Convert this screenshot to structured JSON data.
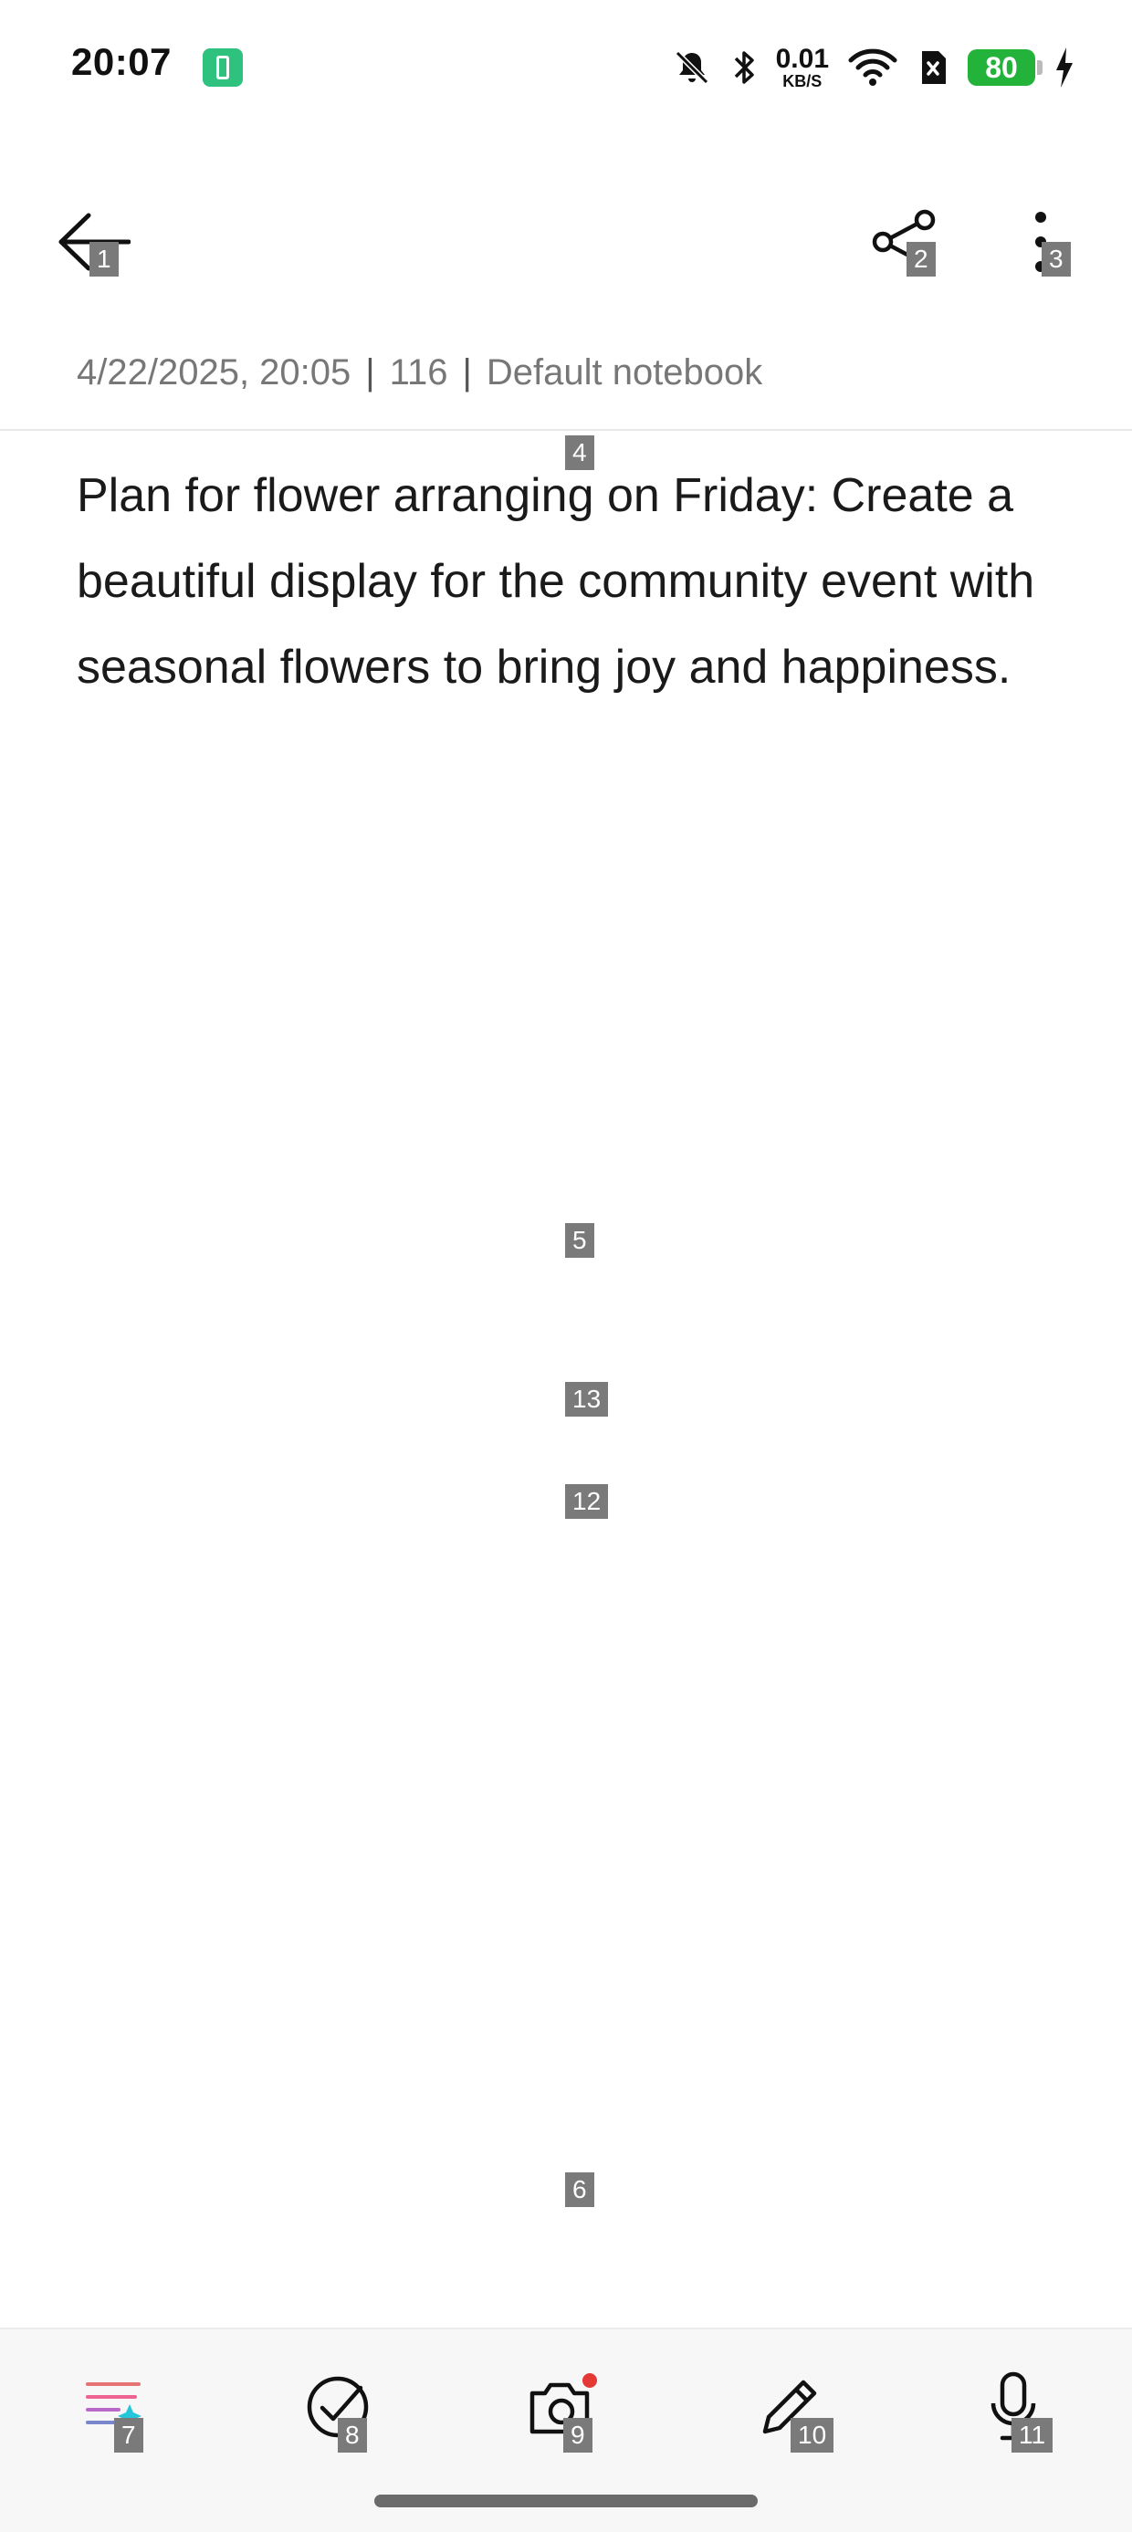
{
  "status_bar": {
    "time": "20:07",
    "net_speed_value": "0.01",
    "net_speed_unit": "KB/S",
    "battery_level": "80",
    "battery_color": "#23b23a"
  },
  "toolbar": {
    "back_icon": "back-arrow-icon",
    "share_icon": "share-icon",
    "more_icon": "more-vertical-icon"
  },
  "note": {
    "date": "4/22/2025, 20:05",
    "char_count": "116",
    "notebook": "Default notebook",
    "body": "Plan for flower arranging on Friday: Create a beautiful display for the community event with seasonal flowers to bring joy and happiness."
  },
  "bottom_toolbar": {
    "items": [
      {
        "icon": "ai-format-icon"
      },
      {
        "icon": "checklist-icon"
      },
      {
        "icon": "camera-icon",
        "badge_color": "#e53935"
      },
      {
        "icon": "pen-icon"
      },
      {
        "icon": "microphone-icon"
      }
    ]
  },
  "markers": [
    "1",
    "2",
    "3",
    "4",
    "5",
    "6",
    "7",
    "8",
    "9",
    "10",
    "11",
    "12",
    "13"
  ]
}
